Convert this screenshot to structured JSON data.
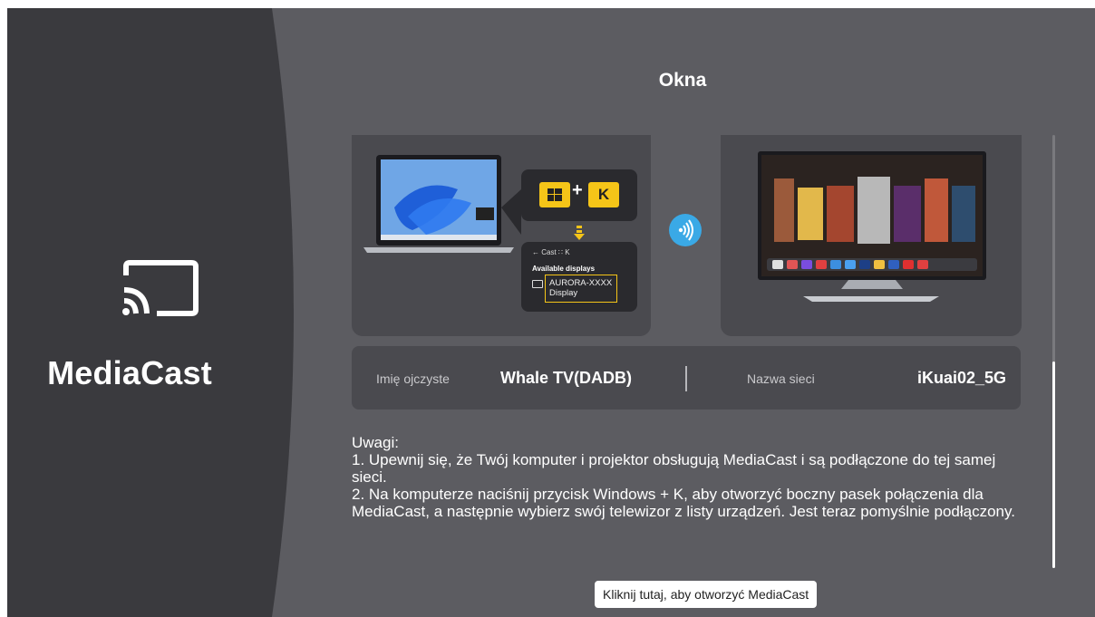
{
  "app": {
    "name": "MediaCast",
    "icon": "cast-icon"
  },
  "page": {
    "title": "Okna"
  },
  "illustration": {
    "keys": {
      "windows_key_icon": "windows-logo-icon",
      "plus": "+",
      "letter_key": "K"
    },
    "popup": {
      "header": "←  Cast    ∷  K",
      "available_label": "Available displays",
      "device_line1": "AURORA-XXXX",
      "device_line2": "Display"
    }
  },
  "info": {
    "device_name_label": "Imię ojczyste",
    "device_name_value": "Whale TV(DADB)",
    "network_label": "Nazwa sieci",
    "network_value": "iKuai02_5G"
  },
  "notes": {
    "heading": "Uwagi:",
    "line1": "1. Upewnij się, że Twój komputer i projektor obsługują MediaCast i są podłączone do tej samej sieci.",
    "line2": "2. Na komputerze naciśnij przycisk Windows + K, aby otworzyć boczny pasek połączenia dla MediaCast, a następnie wybierz swój telewizor z listy urządzeń. Jest teraz pomyślnie podłączony."
  },
  "actions": {
    "open_button": "Kliknij tutaj, aby otworzyć MediaCast"
  },
  "colors": {
    "background": "#5c5c61",
    "left_panel": "#3a3a3e",
    "card": "#4a4a4f",
    "accent_yellow": "#f5c518",
    "accent_blue": "#3aa9e6"
  }
}
